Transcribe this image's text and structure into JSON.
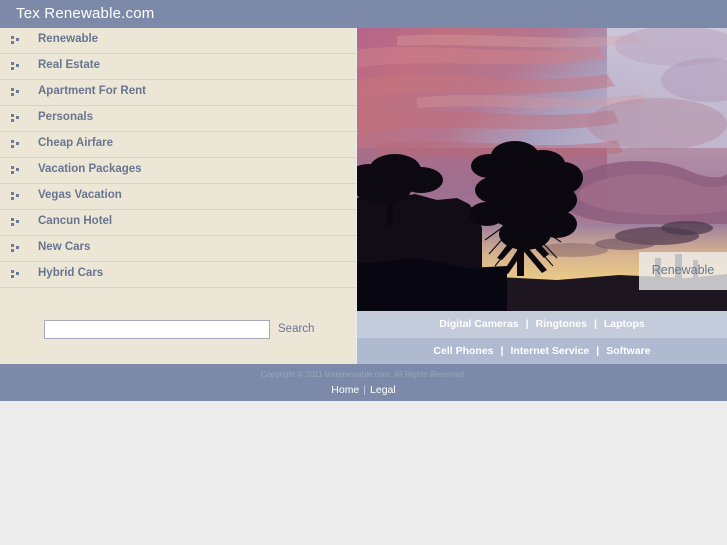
{
  "header": {
    "title": "Tex Renewable.com",
    "bg_color": "#7c89a8",
    "text_color": "#ffffff"
  },
  "sidebar": {
    "bg_color": "#ece6d7",
    "link_color": "#69758f",
    "bullet_icon": "three-square-bullet-icon",
    "items": [
      {
        "label": "Renewable"
      },
      {
        "label": "Real Estate"
      },
      {
        "label": "Apartment For Rent"
      },
      {
        "label": "Personals"
      },
      {
        "label": "Cheap Airfare"
      },
      {
        "label": "Vacation Packages"
      },
      {
        "label": "Vegas Vacation"
      },
      {
        "label": "Cancun Hotel"
      },
      {
        "label": "New Cars"
      },
      {
        "label": "Hybrid Cars"
      }
    ]
  },
  "search": {
    "value": "",
    "placeholder": "",
    "button_label": "Search"
  },
  "hero": {
    "alt": "sunset-sky-with-tree-silhouettes",
    "badge_label": "Renewable"
  },
  "link_bands": [
    {
      "bg_color": "#c4cbdb",
      "separator": "|",
      "links": [
        "Digital Cameras",
        "Ringtones",
        "Laptops"
      ]
    },
    {
      "bg_color": "#afbad0",
      "separator": "|",
      "links": [
        "Cell Phones",
        "Internet Service",
        "Software"
      ]
    }
  ],
  "footer": {
    "bg_color": "#7c89a8",
    "copyright": "Copyright © 2011 texrenewable.com. All Rights Reserved.",
    "separator": "|",
    "links": [
      "Home",
      "Legal"
    ]
  }
}
